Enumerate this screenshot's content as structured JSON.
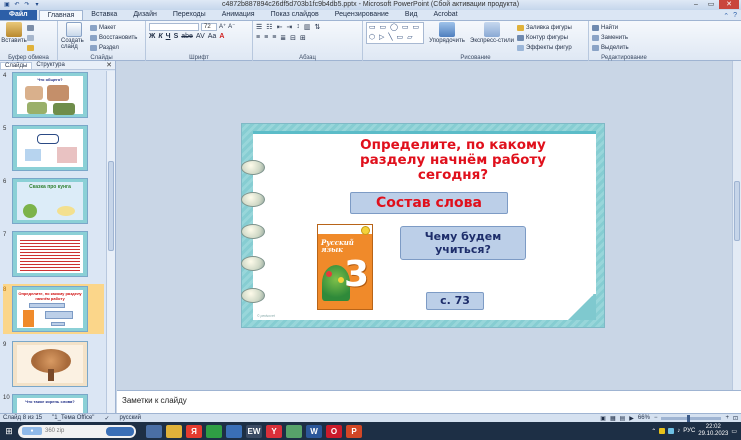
{
  "window": {
    "title": "c4872b887894c26df5d703b1fc9b4db5.pptx - Microsoft PowerPoint (Сбой активации продукта)",
    "quick_access": [
      "save-icon",
      "undo-icon",
      "redo-icon",
      "customize-icon"
    ],
    "controls": [
      "minimize-icon",
      "maximize-icon",
      "close-icon"
    ]
  },
  "ribbon_tabs": [
    {
      "label": "Файл"
    },
    {
      "label": "Главная"
    },
    {
      "label": "Вставка"
    },
    {
      "label": "Дизайн"
    },
    {
      "label": "Переходы"
    },
    {
      "label": "Анимация"
    },
    {
      "label": "Показ слайдов"
    },
    {
      "label": "Рецензирование"
    },
    {
      "label": "Вид"
    },
    {
      "label": "Acrobat"
    }
  ],
  "ribbon": {
    "clipboard": {
      "paste": "Вставить",
      "label": "Буфер обмена"
    },
    "slides": {
      "new_slide": "Создать слайд",
      "layout": "Макет",
      "reset": "Восстановить",
      "section": "Раздел",
      "label": "Слайды"
    },
    "font": {
      "size": "72",
      "label": "Шрифт",
      "format_buttons": [
        "Ж",
        "К",
        "Ч",
        "S",
        "abe",
        "AV",
        "Aa",
        "A"
      ]
    },
    "paragraph": {
      "label": "Абзац"
    },
    "drawing": {
      "arrange": "Упорядочить",
      "quick_styles": "Экспресс-стили",
      "fill": "Заливка фигуры",
      "outline": "Контур фигуры",
      "effects": "Эффекты фигур",
      "label": "Рисование",
      "shapes": "▭ ▭ ◯ ▭ ▭ ⬡ ▷ ╲ ▭ ▱ ⇨ ☆ { } ⌒"
    },
    "editing": {
      "find": "Найти",
      "replace": "Заменить",
      "select": "Выделить",
      "label": "Редактирование"
    }
  },
  "left_panel": {
    "tabs": [
      "Слайды",
      "Структура"
    ],
    "slides": [
      {
        "number": "4",
        "title": "Что общего?"
      },
      {
        "number": "5",
        "title": ""
      },
      {
        "number": "6",
        "title": "Сказка про кунга"
      },
      {
        "number": "7",
        "title": ""
      },
      {
        "number": "8",
        "title": "Определите, по какому разделу начнём работу"
      },
      {
        "number": "9",
        "title": ""
      },
      {
        "number": "10",
        "title": "Что такое корень слова?"
      }
    ]
  },
  "slide": {
    "title": "Определите,  по  какому разделу начнём работу сегодня?",
    "topic": "Состав  слова",
    "question": "Чему  будем учиться?",
    "page": "с. 73",
    "book_title": "Русский язык",
    "book_grade": "3",
    "watermark": "© pedsovet"
  },
  "notes_placeholder": "Заметки к слайду",
  "status_bar": {
    "slide_info": "Слайд 8 из 15",
    "theme": "\"1_Тема Office\"",
    "language": "русский",
    "zoom": "66%"
  },
  "taskbar": {
    "search_text": "360 zip",
    "time": "22:02",
    "date": "29.10.2023",
    "language": "РУС",
    "apps": [
      {
        "name": "task-view-icon",
        "color": "#4a6fa5",
        "glyph": ""
      },
      {
        "name": "file-explorer-icon",
        "color": "#e0b23a",
        "glyph": ""
      },
      {
        "name": "yandex-browser-icon",
        "color": "#e53b2f",
        "glyph": "Я"
      },
      {
        "name": "chrome-icon",
        "color": "#2f9e44",
        "glyph": ""
      },
      {
        "name": "store-icon",
        "color": "#3a6fb6",
        "glyph": ""
      },
      {
        "name": "abbyy-icon",
        "color": "#3a4a63",
        "glyph": "EW"
      },
      {
        "name": "yandex-icon",
        "color": "#d9303a",
        "glyph": "Y"
      },
      {
        "name": "app-icon",
        "color": "#57a36a",
        "glyph": ""
      },
      {
        "name": "word-icon",
        "color": "#2b579a",
        "glyph": "W"
      },
      {
        "name": "opera-icon",
        "color": "#cc1b2b",
        "glyph": "O"
      },
      {
        "name": "powerpoint-icon",
        "color": "#d24726",
        "glyph": "P"
      }
    ]
  }
}
